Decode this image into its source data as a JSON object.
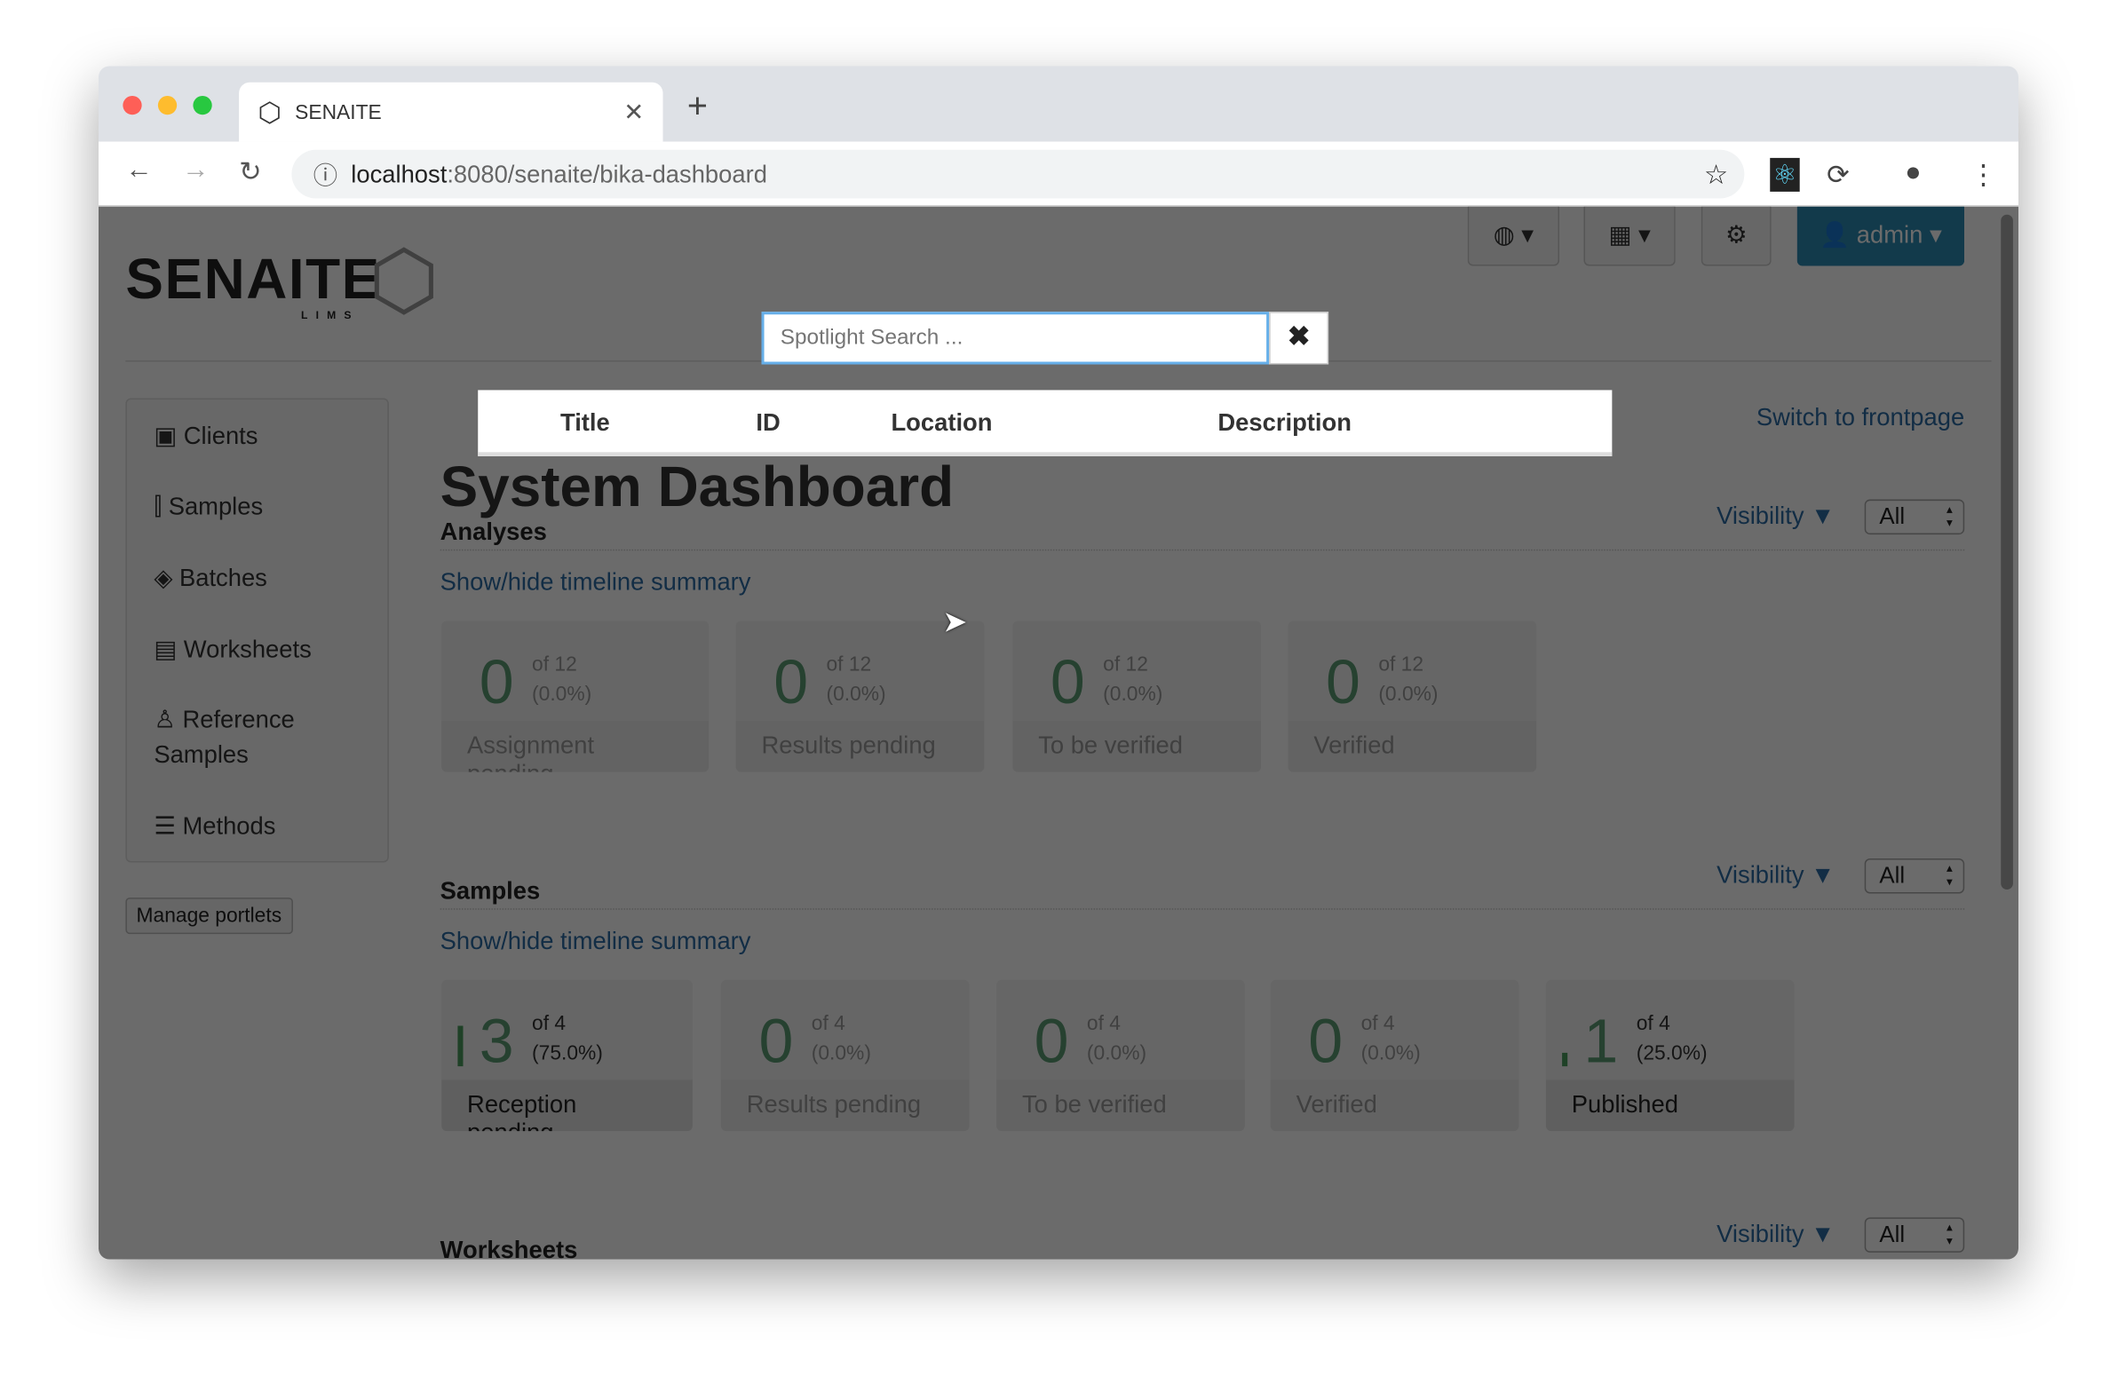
{
  "browser": {
    "tab_title": "SENAITE",
    "url_host": "localhost",
    "url_rest": ":8080/senaite/bika-dashboard"
  },
  "header": {
    "logo": "SENAITE",
    "logo_sub": "LIMS",
    "user": "admin"
  },
  "sidebar": {
    "items": [
      {
        "label": "Clients",
        "icon": "id-card-icon"
      },
      {
        "label": "Samples",
        "icon": "test-tube-icon"
      },
      {
        "label": "Batches",
        "icon": "layers-icon"
      },
      {
        "label": "Worksheets",
        "icon": "clipboard-icon"
      },
      {
        "label": "Reference Samples",
        "icon": "reference-icon"
      },
      {
        "label": "Methods",
        "icon": "list-icon"
      }
    ],
    "manage": "Manage portlets"
  },
  "main": {
    "title": "System Dashboard",
    "switch": "Switch to frontpage",
    "visibility": "Visibility ▼",
    "select": "All",
    "toggle": "Show/hide timeline summary",
    "sections": [
      {
        "title": "Analyses",
        "cards": [
          {
            "num": "0",
            "of": "of 12",
            "pct": "(0.0%)",
            "label": "Assignment pending"
          },
          {
            "num": "0",
            "of": "of 12",
            "pct": "(0.0%)",
            "label": "Results pending"
          },
          {
            "num": "0",
            "of": "of 12",
            "pct": "(0.0%)",
            "label": "To be verified"
          },
          {
            "num": "0",
            "of": "of 12",
            "pct": "(0.0%)",
            "label": "Verified"
          }
        ]
      },
      {
        "title": "Samples",
        "cards": [
          {
            "num": "3",
            "of": "of 4",
            "pct": "(75.0%)",
            "label": "Reception pending",
            "progress": 75
          },
          {
            "num": "0",
            "of": "of 4",
            "pct": "(0.0%)",
            "label": "Results pending"
          },
          {
            "num": "0",
            "of": "of 4",
            "pct": "(0.0%)",
            "label": "To be verified"
          },
          {
            "num": "0",
            "of": "of 4",
            "pct": "(0.0%)",
            "label": "Verified"
          },
          {
            "num": "1",
            "of": "of 4",
            "pct": "(25.0%)",
            "label": "Published",
            "progress": 25
          }
        ]
      },
      {
        "title": "Worksheets"
      }
    ]
  },
  "spotlight": {
    "placeholder": "Spotlight Search ...",
    "close": "✖",
    "columns": [
      "Title",
      "ID",
      "Location",
      "Description"
    ]
  }
}
